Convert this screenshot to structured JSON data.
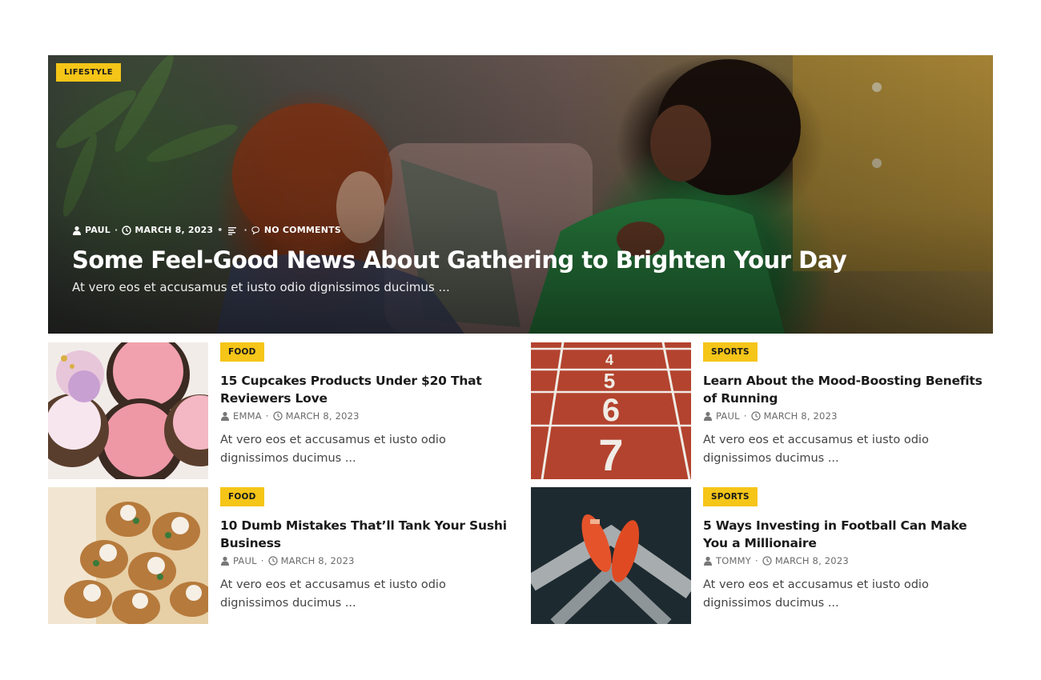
{
  "hero": {
    "category": "LIFESTYLE",
    "author": "PAUL",
    "date": "MARCH 8, 2023",
    "comments": "NO COMMENTS",
    "title": "Some Feel-Good News About Gathering to Brighten Your Day",
    "excerpt": "At vero eos et accusamus et iusto odio dignissimos ducimus ..."
  },
  "cards": [
    {
      "category": "FOOD",
      "title": "15 Cupcakes Products Under $20 That Reviewers Love",
      "author": "EMMA",
      "date": "MARCH 8, 2023",
      "excerpt": "At vero eos et accusamus et iusto odio dignissimos ducimus ..."
    },
    {
      "category": "SPORTS",
      "title": "Learn About the Mood-Boosting Benefits of Running",
      "author": "PAUL",
      "date": "MARCH 8, 2023",
      "excerpt": "At vero eos et accusamus et iusto odio dignissimos ducimus ..."
    },
    {
      "category": "FOOD",
      "title": "10 Dumb Mistakes That’ll Tank Your Sushi Business",
      "author": "PAUL",
      "date": "MARCH 8, 2023",
      "excerpt": "At vero eos et accusamus et iusto odio dignissimos ducimus ..."
    },
    {
      "category": "SPORTS",
      "title": "5 Ways Investing in Football Can Make You a Millionaire",
      "author": "TOMMY",
      "date": "MARCH 8, 2023",
      "excerpt": "At vero eos et accusamus et iusto odio dignissimos ducimus ..."
    }
  ],
  "track_lane_numbers": [
    "4",
    "5",
    "6",
    "7"
  ],
  "colors": {
    "accent": "#f5c518",
    "text": "#1a1a1a",
    "meta": "#6b6b6b"
  }
}
